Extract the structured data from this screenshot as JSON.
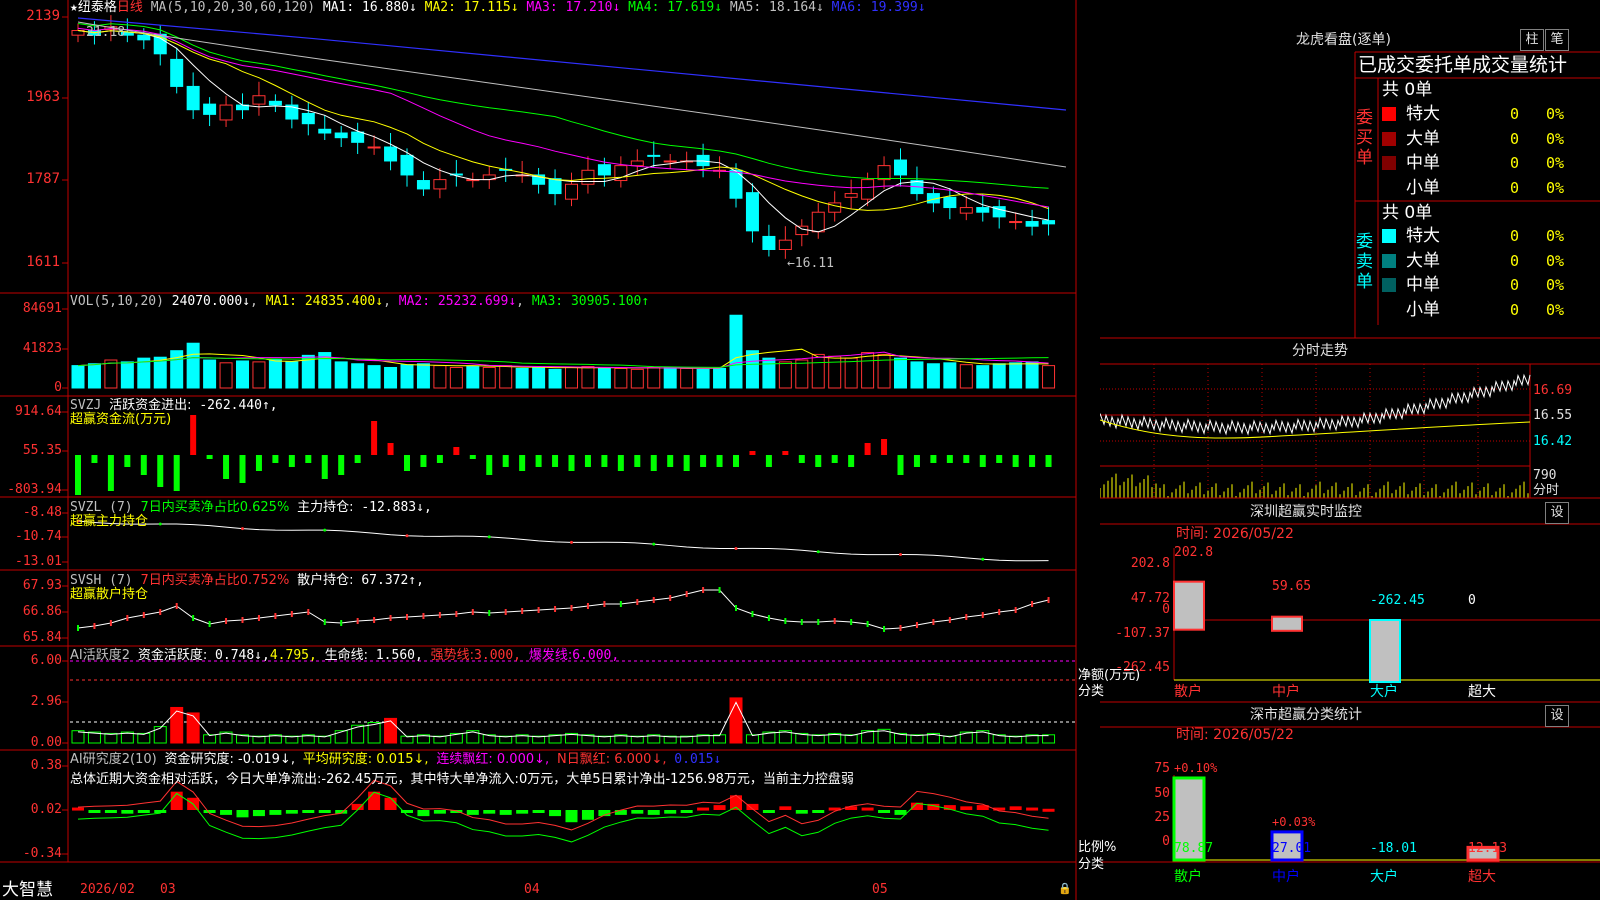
{
  "main_chart": {
    "star": "★",
    "stock_name": "纽泰格",
    "period": "日线",
    "ma_header": "MA(5,10,20,30,60,120)",
    "ma": [
      {
        "label": "MA1:",
        "value": "16.880",
        "arrow": "↓",
        "color": "#ffffff"
      },
      {
        "label": "MA2:",
        "value": "17.115",
        "arrow": "↓",
        "color": "#ffff00"
      },
      {
        "label": "MA3:",
        "value": "17.210",
        "arrow": "↓",
        "color": "#ff00ff"
      },
      {
        "label": "MA4:",
        "value": "17.619",
        "arrow": "↓",
        "color": "#00ff00"
      },
      {
        "label": "MA5:",
        "value": "18.164",
        "arrow": "↓",
        "color": "#c0c0c0"
      },
      {
        "label": "MA6:",
        "value": "19.399",
        "arrow": "↓",
        "color": "#3030ff"
      }
    ],
    "y_ticks": [
      "2139",
      "1963",
      "1787",
      "1611"
    ],
    "high_label": "21.18",
    "low_label": "←16.11",
    "colors": {
      "up": "#ff3232",
      "down": "#00ffff"
    }
  },
  "vol_panel": {
    "header": "VOL(5,10,20)",
    "value": "24070.000↓",
    "ma": [
      {
        "text": "MA1: 24835.400↓",
        "color": "#ffff00"
      },
      {
        "text": "MA2: 25232.699↓",
        "color": "#ff00ff"
      },
      {
        "text": "MA3: 30905.100↑",
        "color": "#00ff00"
      }
    ],
    "y_ticks": [
      "84691",
      "41823",
      "0"
    ]
  },
  "svzj_panel": {
    "header": "SVZJ",
    "title": "活跃资金进出:",
    "value": "-262.440↑,",
    "subtitle": "超赢资金流(万元)",
    "y_ticks": [
      "914.64",
      "55.35",
      "-803.94"
    ]
  },
  "svzl_panel": {
    "header": "SVZL (7)",
    "ratio": "7日内买卖净占比0.625%",
    "label": "主力持仓:",
    "value": "-12.883↓,",
    "subtitle": "超赢主力持仓",
    "y_ticks": [
      "-8.48",
      "-10.74",
      "-13.01"
    ]
  },
  "svsh_panel": {
    "header": "SVSH (7)",
    "ratio": "7日内买卖净占比0.752%",
    "label": "散户持仓:",
    "value": "67.372↑,",
    "subtitle": "超赢散户持仓",
    "y_ticks": [
      "67.93",
      "66.86",
      "65.84"
    ]
  },
  "ai_active_panel": {
    "header": "AI活跃度2",
    "label": "资金活跃度:",
    "value1": "0.748↓,",
    "value2": "4.795,",
    "life_label": "生命线:",
    "life_value": "1.560,",
    "strong_label": "强势线:",
    "strong_value": "3.000,",
    "burst_label": "爆发线:",
    "burst_value": "6.000,",
    "y_ticks": [
      "6.00",
      "2.96",
      "0.00"
    ]
  },
  "ai_research_panel": {
    "header": "AI研究度2(10)",
    "r1": "资金研究度: -0.019↓,",
    "r2": "平均研究度: 0.015↓,",
    "r3": "连续飘红: 0.000↓,",
    "r4": "N日飘红: 6.000↓,",
    "r5": "0.015↓",
    "summary": "总体近期大资金相对活跃，今日大单净流出:-262.45万元，其中特大单净流入:0万元，大单5日累计净出-1256.98万元，当前主力控盘弱",
    "y_ticks": [
      "0.38",
      "0.02",
      "-0.34"
    ]
  },
  "bottom_bar": {
    "brand": "大智慧",
    "dates": [
      "2026/02",
      "03",
      "04",
      "05"
    ]
  },
  "right_panel": {
    "dragon_title": "龙虎看盘(逐单)",
    "btn_bar": "柱",
    "btn_pen": "笔",
    "stats_title": "已成交委托单成交量统计",
    "buy_side": {
      "label": "委买单",
      "total": "共 0单",
      "rows": [
        {
          "name": "特大",
          "count": "0",
          "pct": "0%",
          "color": "#ff0000"
        },
        {
          "name": "大单",
          "count": "0",
          "pct": "0%",
          "color": "#a00000"
        },
        {
          "name": "中单",
          "count": "0",
          "pct": "0%",
          "color": "#800000"
        },
        {
          "name": "小单",
          "count": "0",
          "pct": "0%",
          "color": "#000000"
        }
      ]
    },
    "sell_side": {
      "label": "委卖单",
      "total": "共 0单",
      "rows": [
        {
          "name": "特大",
          "count": "0",
          "pct": "0%",
          "color": "#00ffff"
        },
        {
          "name": "大单",
          "count": "0",
          "pct": "0%",
          "color": "#008080"
        },
        {
          "name": "中单",
          "count": "0",
          "pct": "0%",
          "color": "#006060"
        },
        {
          "name": "小单",
          "count": "0",
          "pct": "0%",
          "color": "#000000"
        }
      ]
    },
    "intraday": {
      "title": "分时走势",
      "y_labels": [
        "16.69",
        "16.55",
        "16.42",
        "790"
      ],
      "unit": "分时"
    },
    "sz_monitor": {
      "title": "深圳超赢实时监控",
      "settings": "设",
      "time": "时间: 2026/05/22",
      "y_ticks": [
        "202.8",
        "47.72",
        "0",
        "-107.37",
        "-262.45"
      ],
      "unit_label": "净额(万元)",
      "cat_label": "分类",
      "bars": [
        {
          "name": "散户",
          "value": "202.8",
          "num": 202.8,
          "color": "#ff3232"
        },
        {
          "name": "中户",
          "value": "59.65",
          "num": 59.65,
          "color": "#ff3232"
        },
        {
          "name": "大户",
          "value": "-262.45",
          "num": -262.45,
          "color": "#00ffff"
        },
        {
          "name": "超大",
          "value": "0",
          "num": 0,
          "color": "#ffffff"
        }
      ]
    },
    "sz_classify": {
      "title": "深市超赢分类统计",
      "settings": "设",
      "time": "时间: 2026/05/22",
      "y_ticks": [
        "75",
        "50",
        "25",
        "0"
      ],
      "ratio_label": "比例%",
      "cat_label": "分类",
      "bars": [
        {
          "name": "散户",
          "value": "78.87",
          "top": "+0.10%",
          "num": 78.87,
          "fill": "#c0c0c0",
          "edge": "#00ff00",
          "val_color": "#00ff00",
          "top_color": "#ff3232"
        },
        {
          "name": "中户",
          "value": "27.01",
          "top": "+0.03%",
          "num": 27.01,
          "fill": "#c0c0c0",
          "edge": "#0000ff",
          "val_color": "#0000ff",
          "top_color": "#ff3232"
        },
        {
          "name": "大户",
          "value": "-18.01",
          "top": "",
          "num": 0,
          "fill": "#c0c0c0",
          "edge": "#00ffff",
          "val_color": "#00ffff",
          "top_color": "#ff3232"
        },
        {
          "name": "超大",
          "value": "12.13",
          "top": "",
          "num": 12.13,
          "fill": "#c0c0c0",
          "edge": "#ff3232",
          "val_color": "#ff3232",
          "top_color": "#ff3232"
        }
      ]
    }
  }
}
